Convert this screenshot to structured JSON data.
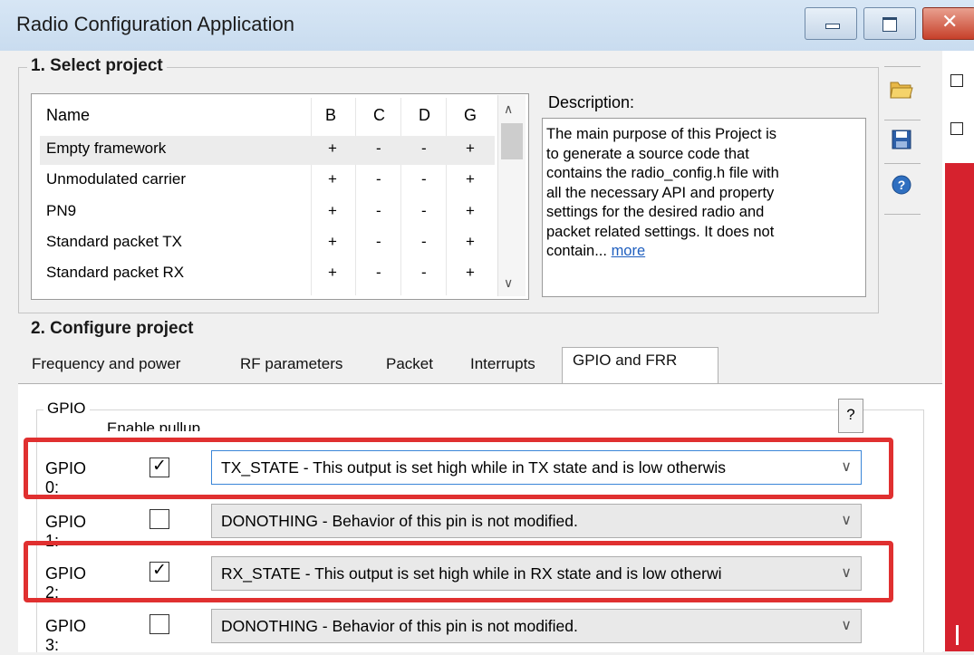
{
  "window": {
    "title": "Radio Configuration Application"
  },
  "select_project": {
    "legend": "1. Select project",
    "columns": [
      "Name",
      "B",
      "C",
      "D",
      "G"
    ],
    "rows": [
      {
        "name": "Empty framework",
        "B": "+",
        "C": "-",
        "D": "-",
        "G": "+"
      },
      {
        "name": "Unmodulated carrier",
        "B": "+",
        "C": "-",
        "D": "-",
        "G": "+"
      },
      {
        "name": "PN9",
        "B": "+",
        "C": "-",
        "D": "-",
        "G": "+"
      },
      {
        "name": "Standard packet TX",
        "B": "+",
        "C": "-",
        "D": "-",
        "G": "+"
      },
      {
        "name": "Standard packet RX",
        "B": "+",
        "C": "-",
        "D": "-",
        "G": "+"
      }
    ],
    "description_label": "Description:",
    "description_lines": [
      "The main purpose of this Project is",
      "to generate a source code that",
      "contains the radio_config.h file with",
      "all the necessary API and property",
      "settings for the desired radio and",
      "packet related settings. It does not"
    ],
    "description_last": "contain...",
    "more_link": "more"
  },
  "configure_project": {
    "legend": "2. Configure project",
    "tabs": [
      "Frequency and power",
      "RF parameters",
      "Packet",
      "Interrupts",
      "GPIO and FRR"
    ],
    "active_tab": "GPIO and FRR"
  },
  "gpio": {
    "legend": "GPIO",
    "enable_pullup_label": "Enable pullup",
    "help_label": "?",
    "rows": [
      {
        "label": "GPIO 0:",
        "checked": true,
        "value": "TX_STATE - This output is set high while in TX state and is low otherwis",
        "highlighted": true,
        "focused": true
      },
      {
        "label": "GPIO 1:",
        "checked": false,
        "value": "DONOTHING - Behavior of this pin is not modified.",
        "highlighted": false,
        "focused": false
      },
      {
        "label": "GPIO 2:",
        "checked": true,
        "value": "RX_STATE - This output is set high while in RX state and is low otherwi",
        "highlighted": true,
        "focused": false
      },
      {
        "label": "GPIO 3:",
        "checked": false,
        "value": "DONOTHING - Behavior of this pin is not modified.",
        "highlighted": false,
        "focused": false
      }
    ]
  },
  "toolbar": {
    "icons": [
      "open-folder-icon",
      "save-icon",
      "help-icon"
    ]
  },
  "colors": {
    "highlight": "#e03030",
    "titlebar": "#c9dcef",
    "link": "#1f5fbf",
    "side_accent": "#d6222e"
  }
}
